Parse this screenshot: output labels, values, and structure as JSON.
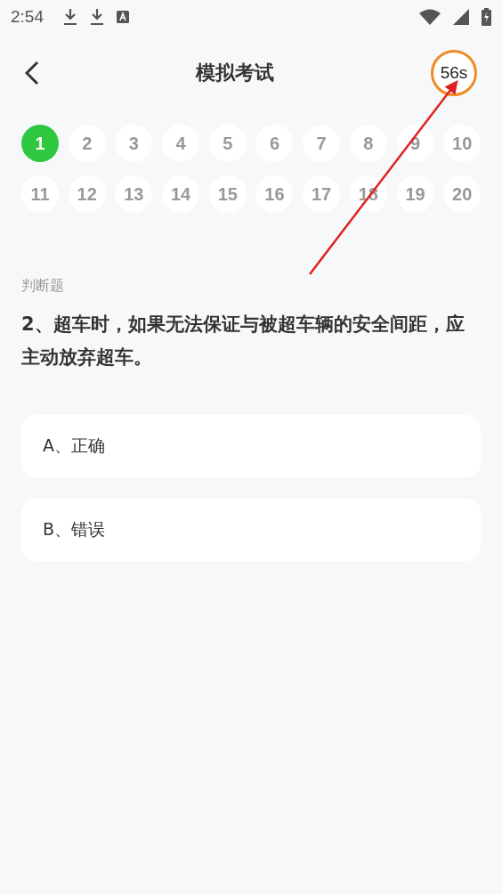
{
  "status_bar": {
    "time": "2:54"
  },
  "header": {
    "title": "模拟考试",
    "timer": "56s"
  },
  "question_nav": [
    {
      "label": "1",
      "selected": true
    },
    {
      "label": "2",
      "selected": false
    },
    {
      "label": "3",
      "selected": false
    },
    {
      "label": "4",
      "selected": false
    },
    {
      "label": "5",
      "selected": false
    },
    {
      "label": "6",
      "selected": false
    },
    {
      "label": "7",
      "selected": false
    },
    {
      "label": "8",
      "selected": false
    },
    {
      "label": "9",
      "selected": false
    },
    {
      "label": "10",
      "selected": false
    },
    {
      "label": "11",
      "selected": false
    },
    {
      "label": "12",
      "selected": false
    },
    {
      "label": "13",
      "selected": false
    },
    {
      "label": "14",
      "selected": false
    },
    {
      "label": "15",
      "selected": false
    },
    {
      "label": "16",
      "selected": false
    },
    {
      "label": "17",
      "selected": false
    },
    {
      "label": "18",
      "selected": false
    },
    {
      "label": "19",
      "selected": false
    },
    {
      "label": "20",
      "selected": false
    }
  ],
  "question": {
    "type": "判断题",
    "text": "2、超车时，如果无法保证与被超车辆的安全间距，应主动放弃超车。"
  },
  "options": [
    "A、正确",
    "B、错误"
  ]
}
